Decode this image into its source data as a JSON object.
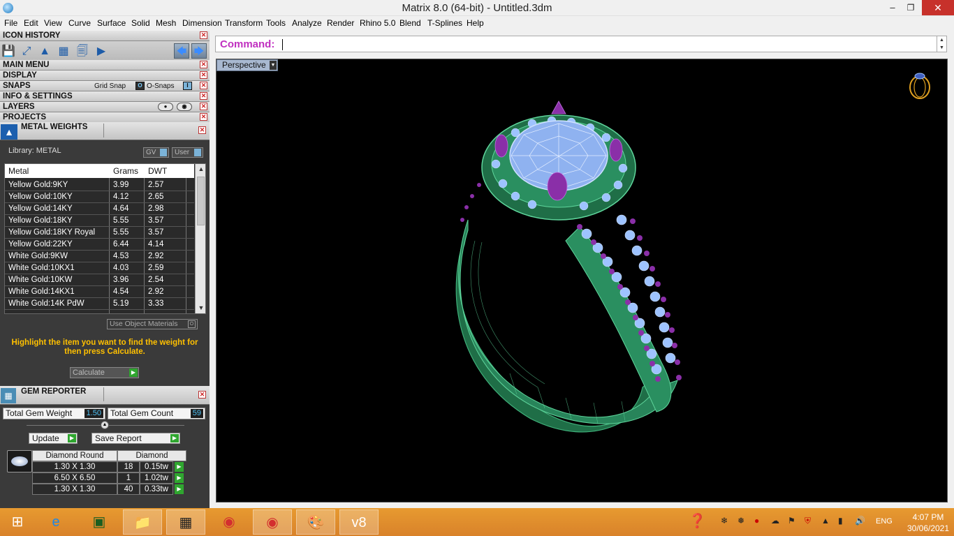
{
  "window": {
    "title": "Matrix 8.0 (64-bit) - Untitled.3dm"
  },
  "menu": [
    "File",
    "Edit",
    "View",
    "Curve",
    "Surface",
    "Solid",
    "Mesh",
    "Dimension",
    "Transform",
    "Tools",
    "Analyze",
    "Render",
    "Rhino 5.0",
    "Blend",
    "T-Splines",
    "Help"
  ],
  "panels": {
    "icon_history": "ICON HISTORY",
    "main_menu": "MAIN MENU",
    "display": "DISPLAY",
    "snaps": "SNAPS",
    "grid_snap": "Grid Snap",
    "o_snaps": "O-Snaps",
    "info_settings": "INFO & SETTINGS",
    "layers": "LAYERS",
    "projects": "PROJECTS"
  },
  "metal_weights": {
    "title": "METAL WEIGHTS",
    "library": "Library: METAL",
    "gv": "GV",
    "user": "User",
    "columns": [
      "Metal",
      "Grams",
      "DWT"
    ],
    "rows": [
      [
        "Yellow Gold:9KY",
        "3.99",
        "2.57"
      ],
      [
        "Yellow Gold:10KY",
        "4.12",
        "2.65"
      ],
      [
        "Yellow Gold:14KY",
        "4.64",
        "2.98"
      ],
      [
        "Yellow Gold:18KY",
        "5.55",
        "3.57"
      ],
      [
        "Yellow Gold:18KY Royal",
        "5.55",
        "3.57"
      ],
      [
        "Yellow Gold:22KY",
        "6.44",
        "4.14"
      ],
      [
        "White Gold:9KW",
        "4.53",
        "2.92"
      ],
      [
        "White Gold:10KX1",
        "4.03",
        "2.59"
      ],
      [
        "White Gold:10KW",
        "3.96",
        "2.54"
      ],
      [
        "White Gold:14KX1",
        "4.54",
        "2.92"
      ],
      [
        "White Gold:14K PdW",
        "5.19",
        "3.33"
      ]
    ],
    "use_object": "Use Object Materials",
    "message": "Highlight the item you want to find the weight for then press Calculate.",
    "calculate": "Calculate"
  },
  "gem_reporter": {
    "title": "GEM REPORTER",
    "total_weight_label": "Total Gem Weight",
    "total_weight": "1.50",
    "total_count_label": "Total Gem Count",
    "total_count": "59",
    "update": "Update",
    "save_report": "Save Report",
    "head_shape": "Diamond Round",
    "head_type": "Diamond",
    "rows": [
      [
        "1.30 X 1.30",
        "18",
        "0.15tw"
      ],
      [
        "6.50 X 6.50",
        "1",
        "1.02tw"
      ],
      [
        "1.30 X 1.30",
        "40",
        "0.33tw"
      ]
    ]
  },
  "command": {
    "label": "Command:"
  },
  "viewport": {
    "name": "Perspective"
  },
  "taskbar": {
    "lang": "ENG",
    "time": "4:07 PM",
    "date": "30/06/2021"
  },
  "colors": {
    "metal": "#2e8b5a",
    "gem": "#9ec3ff",
    "prong": "#8a2fa8",
    "cmd": "#c030c0",
    "message": "#ffc000"
  }
}
